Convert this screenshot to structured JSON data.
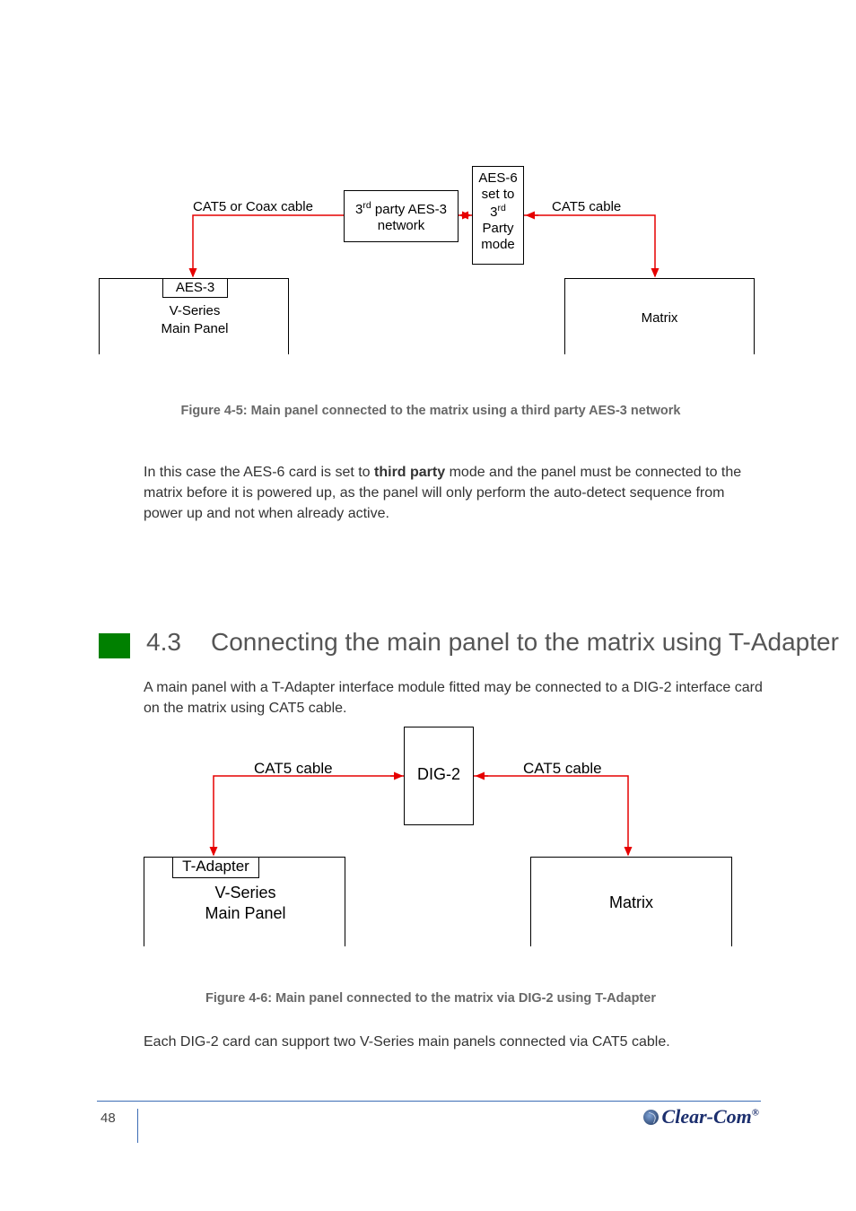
{
  "diagram1": {
    "cat5coax": "CAT5 or Coax cable",
    "cat5r": "CAT5 cable",
    "third_party_net_l1": "3",
    "third_party_net_sup": "rd",
    "third_party_net_l1b": " party AES-3",
    "third_party_net_l2": "network",
    "aes6_l1": "AES-6",
    "aes6_l2": "set to",
    "aes6_l3a": "3",
    "aes6_l3sup": "rd",
    "aes6_l4": "Party",
    "aes6_l5": "mode",
    "aes3": "AES-3",
    "vseries_l1": "V-Series",
    "vseries_l2": "Main Panel",
    "matrix": "Matrix"
  },
  "figcap1": "Figure 4-5: Main panel connected to the matrix using a third party AES-3 network",
  "para1_a": "In this case the AES-6 card is set to ",
  "para1_b": "third party",
  "para1_c": " mode and the panel must be connected to the matrix before it is powered up, as the panel will only perform the auto-detect sequence from power up and not when already active.",
  "sec43_num": "4.3",
  "sec43_txt": "Connecting the main panel to the matrix using T-Adapter",
  "para2": "A main panel with a T-Adapter interface module fitted may be connected to a DIG-2 interface card on the matrix using CAT5 cable.",
  "diagram2": {
    "catl": "CAT5 cable",
    "catr": "CAT5 cable",
    "dig2": "DIG-2",
    "tadapter": "T-Adapter",
    "vseries_l1": "V-Series",
    "vseries_l2": "Main Panel",
    "matrix": "Matrix"
  },
  "figcap2": "Figure 4-6: Main panel connected to the matrix via DIG-2 using T-Adapter",
  "para3": "Each DIG-2 card can support two V-Series main panels connected via CAT5 cable.",
  "footer_page": "48",
  "footer_brand": "Clear-Com"
}
